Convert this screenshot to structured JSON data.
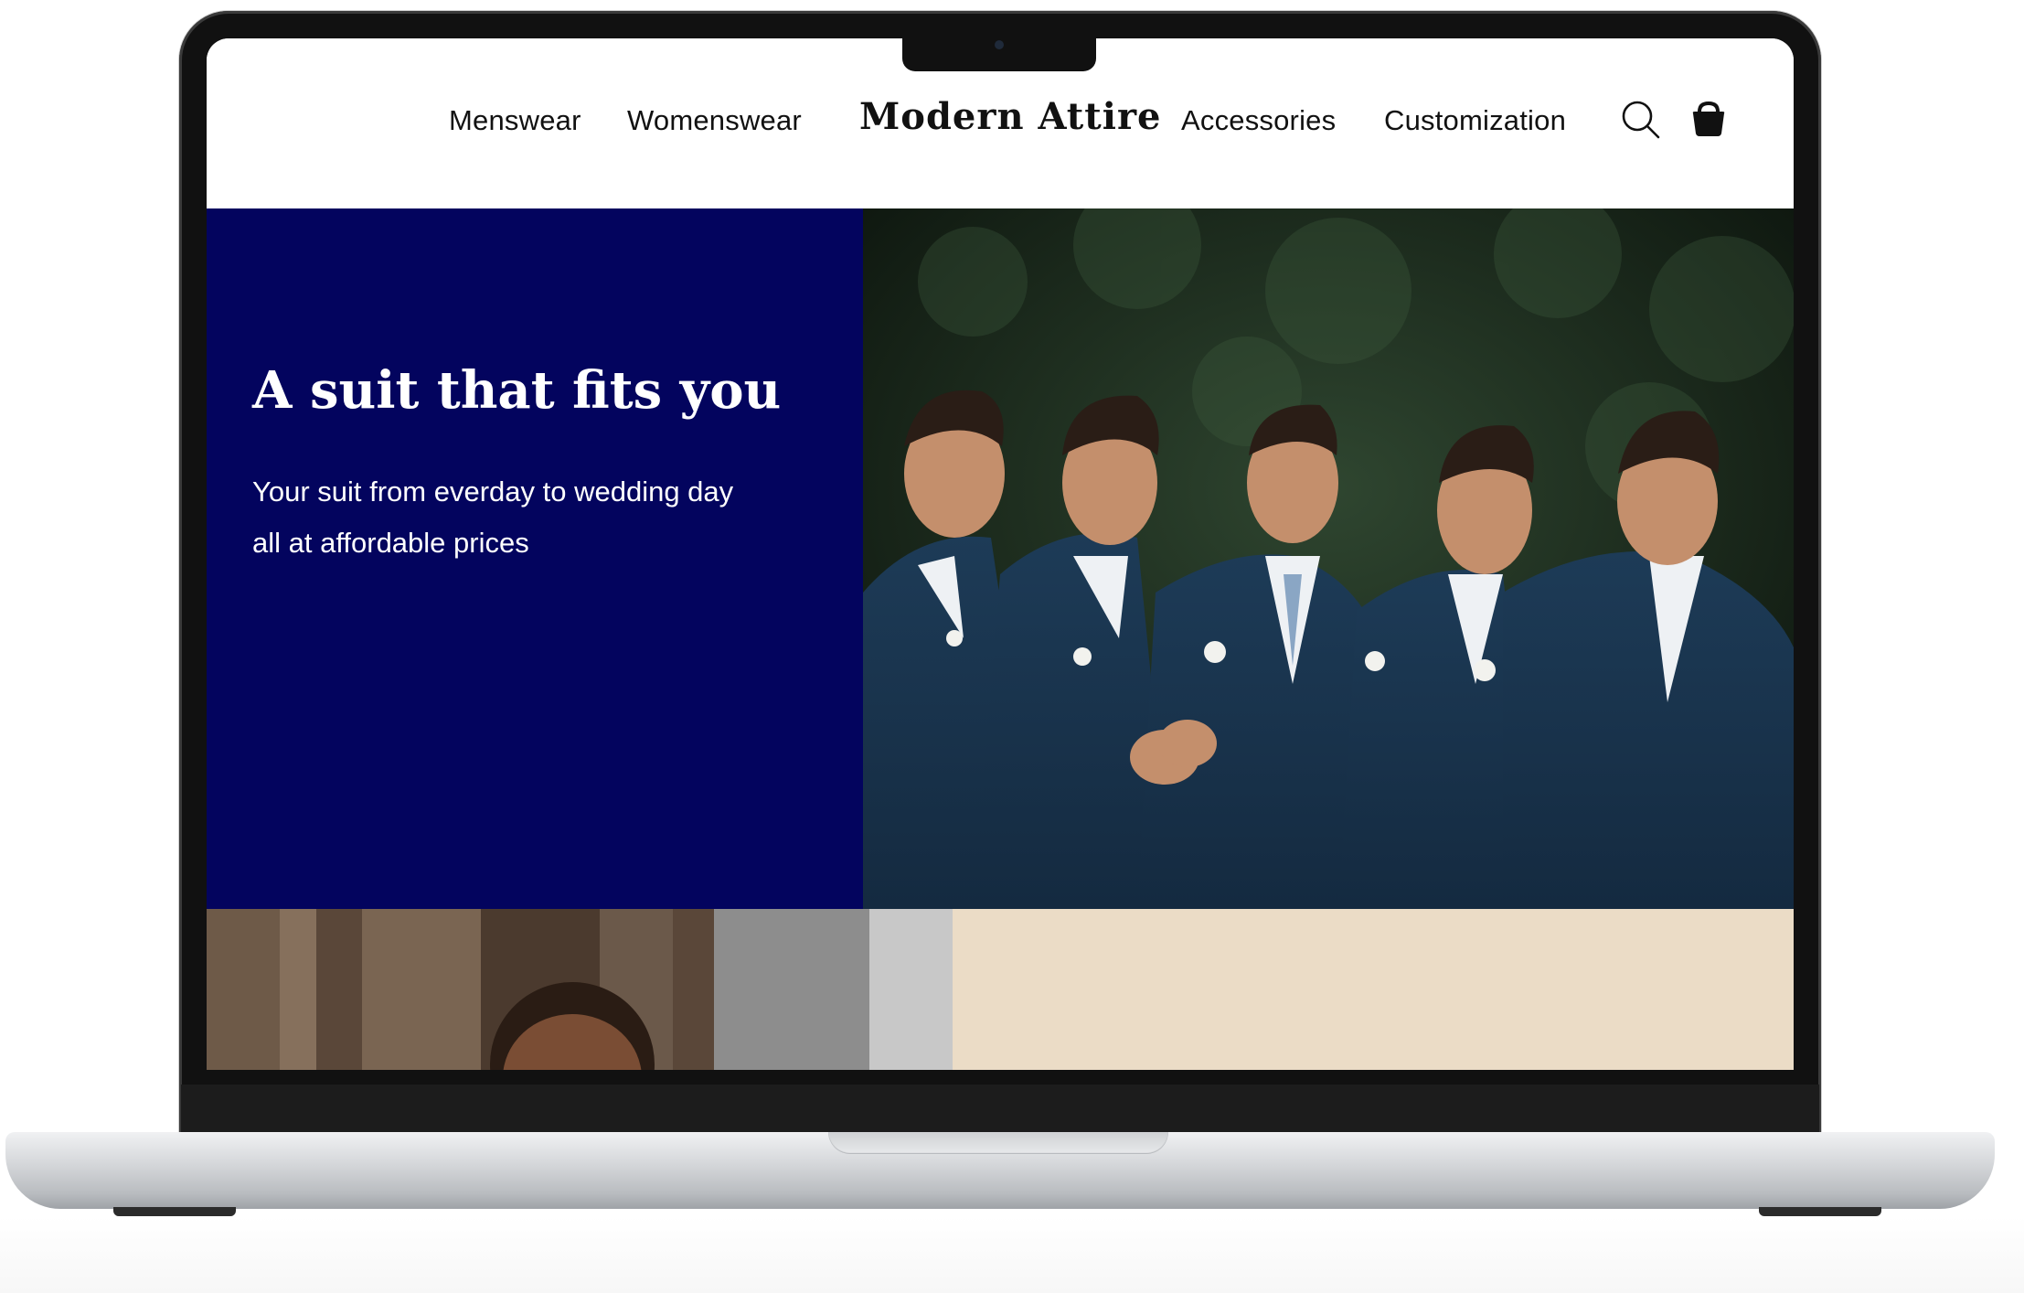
{
  "nav": {
    "menswear": "Menswear",
    "womenswear": "Womenswear",
    "logo": "Modern Attire",
    "accessories": "Accessories",
    "customization": "Customization",
    "search_icon": "search-icon",
    "cart_icon": "shopping-bag-icon"
  },
  "hero": {
    "title": "A suit that fits you",
    "subtitle": "Your suit from everday to wedding day all at affordable prices",
    "image": "five groomsmen in navy suits joining hands"
  },
  "colors": {
    "hero_panel": "#03045e",
    "beige_panel": "#ebdcc6",
    "text_dark": "#111111",
    "text_light": "#ffffff"
  }
}
